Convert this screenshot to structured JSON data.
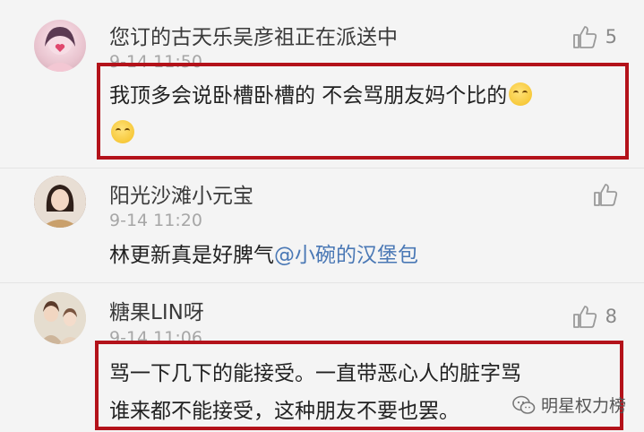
{
  "comments": [
    {
      "username": "您订的古天乐吴彦祖正在派送中",
      "timestamp": "9-14 11:50",
      "text_line1": "我顶多会说卧槽卧槽的  不会骂朋友妈个比的",
      "likes": "5",
      "emoji": "laughing-crying-emoji",
      "highlighted": true
    },
    {
      "username": "阳光沙滩小元宝",
      "timestamp": "9-14 11:20",
      "text_prefix": "林更新真是好脾气",
      "mention": "@小碗的汉堡包",
      "likes": "",
      "highlighted": false
    },
    {
      "username": "糖果LIN呀",
      "timestamp": "9-14 11:06",
      "text_line1": "骂一下几下的能接受。一直带恶心人的脏字骂",
      "text_line2": "谁来都不能接受，这种朋友不要也罢。",
      "likes": "8",
      "highlighted": true
    }
  ],
  "watermark": {
    "label": "明星权力榜",
    "icon": "wechat-icon"
  },
  "colors": {
    "background": "#f4f4f4",
    "highlight_border": "#b3121a",
    "mention": "#4a78b5",
    "timestamp": "#a6a6a6"
  }
}
